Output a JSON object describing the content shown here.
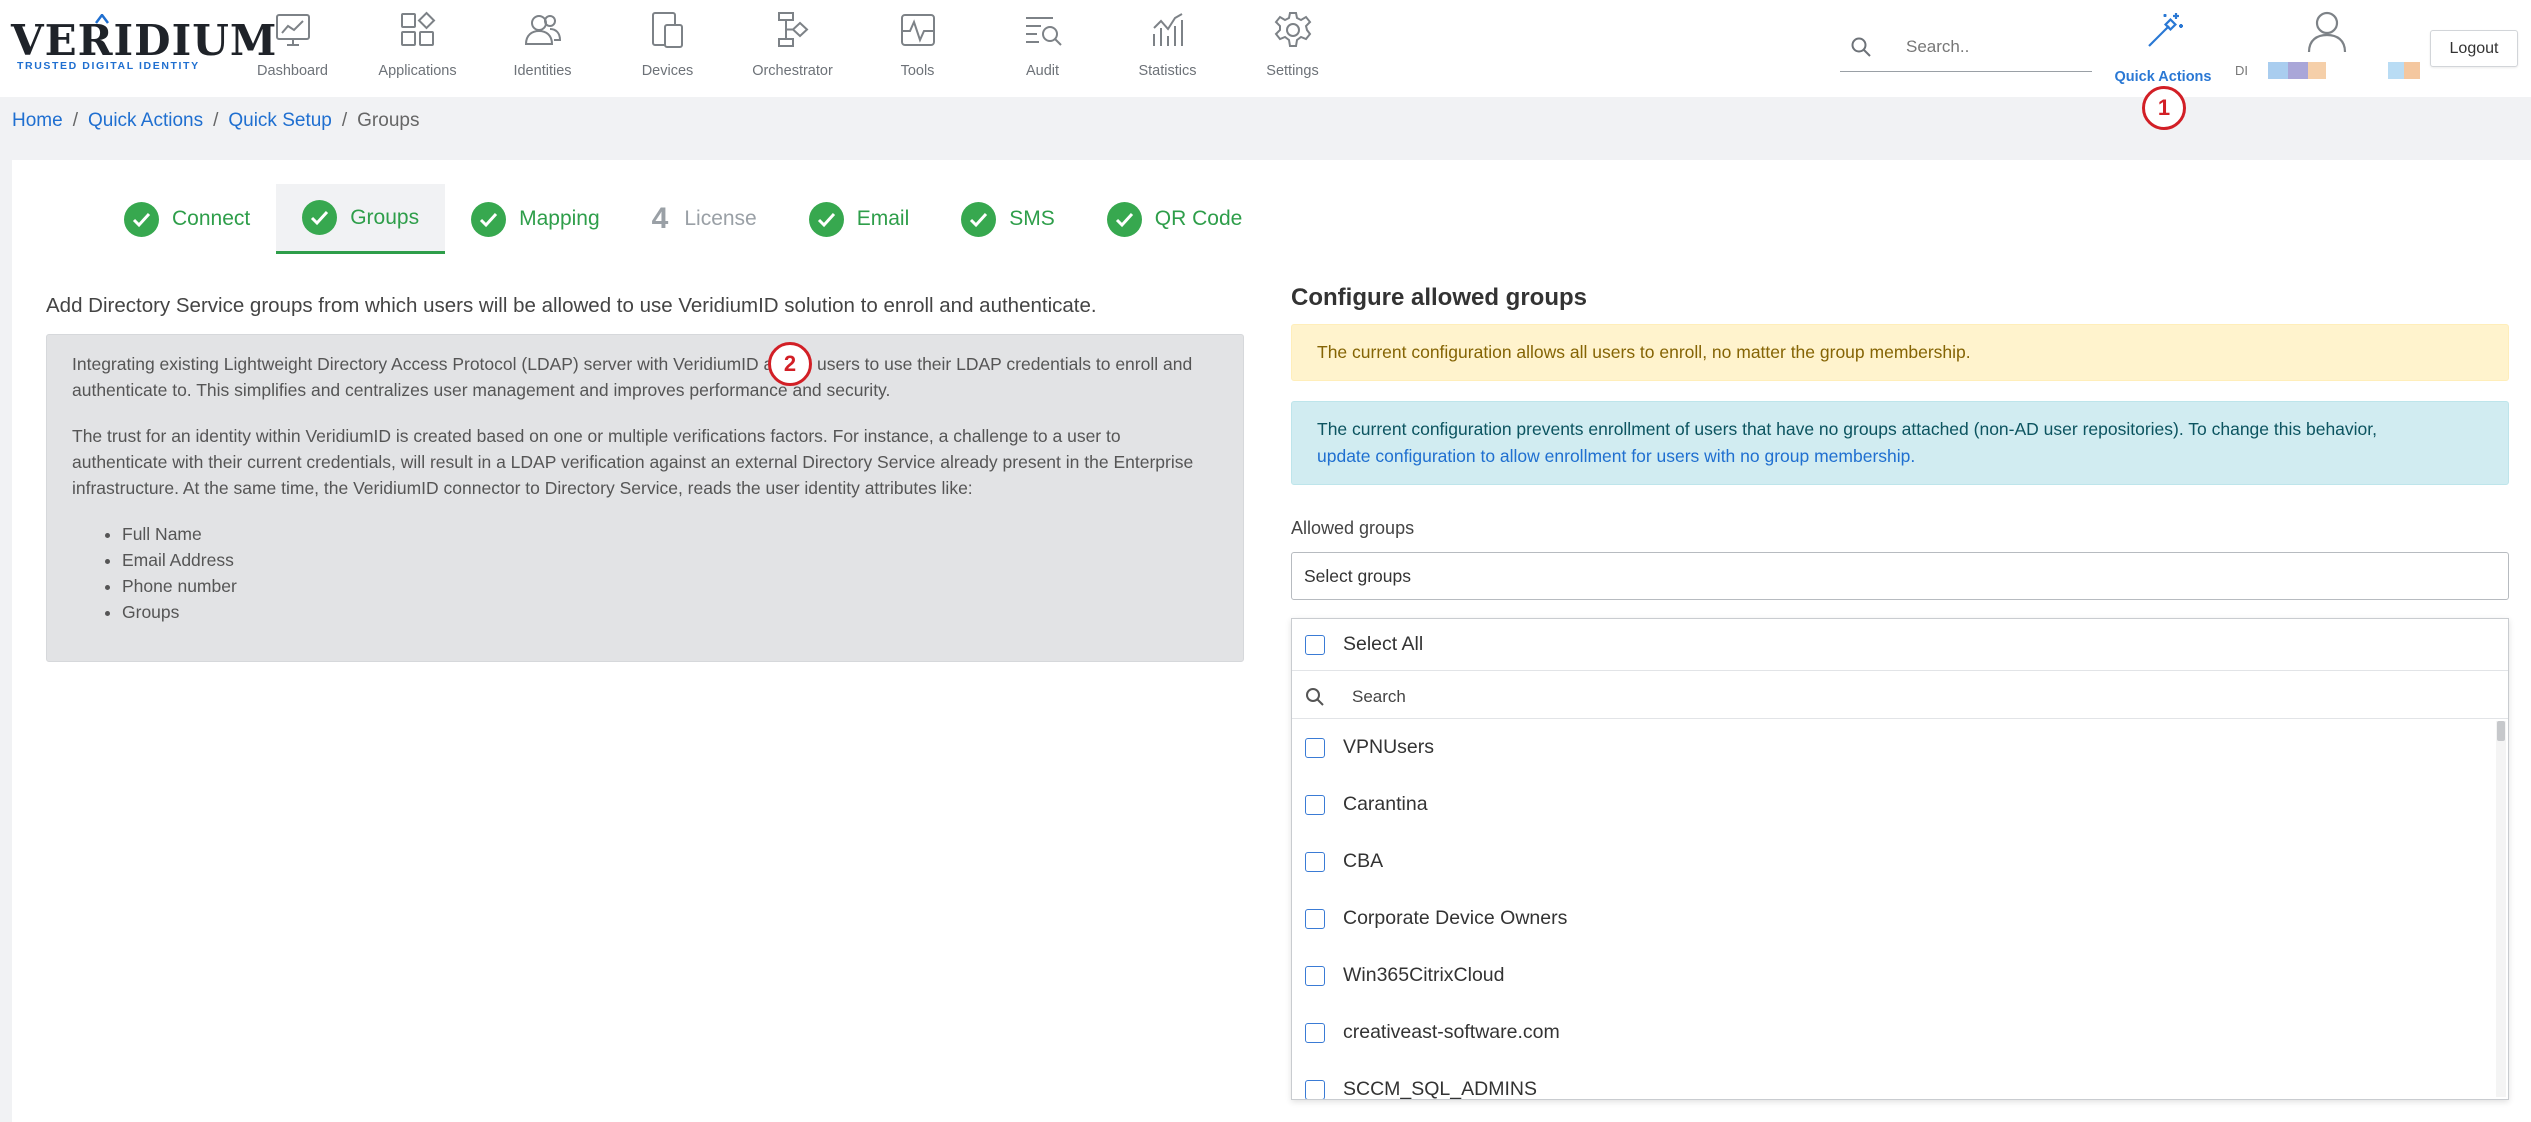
{
  "logo": {
    "word": "VERIDIUM",
    "tagline": "TRUSTED DIGITAL IDENTITY"
  },
  "nav": [
    {
      "id": "dashboard",
      "label": "Dashboard",
      "icon": "dashboard-icon"
    },
    {
      "id": "applications",
      "label": "Applications",
      "icon": "applications-icon"
    },
    {
      "id": "identities",
      "label": "Identities",
      "icon": "identities-icon"
    },
    {
      "id": "devices",
      "label": "Devices",
      "icon": "devices-icon"
    },
    {
      "id": "orchestrator",
      "label": "Orchestrator",
      "icon": "orchestrator-icon"
    },
    {
      "id": "tools",
      "label": "Tools",
      "icon": "tools-icon"
    },
    {
      "id": "audit",
      "label": "Audit",
      "icon": "audit-icon"
    },
    {
      "id": "statistics",
      "label": "Statistics",
      "icon": "statistics-icon"
    },
    {
      "id": "settings",
      "label": "Settings",
      "icon": "gear-icon"
    }
  ],
  "header": {
    "search_placeholder": "Search..",
    "quick_actions_label": "Quick Actions",
    "user_initials": "DI",
    "logout_label": "Logout"
  },
  "markers": {
    "one": "1",
    "two": "2"
  },
  "breadcrumb": {
    "home": "Home",
    "quick_actions": "Quick Actions",
    "quick_setup": "Quick Setup",
    "current": "Groups",
    "separator": "/"
  },
  "steps": [
    {
      "label": "Connect",
      "status": "done"
    },
    {
      "label": "Groups",
      "status": "active"
    },
    {
      "label": "Mapping",
      "status": "done"
    },
    {
      "label": "License",
      "status": "pending",
      "number": "4"
    },
    {
      "label": "Email",
      "status": "done"
    },
    {
      "label": "SMS",
      "status": "done"
    },
    {
      "label": "QR Code",
      "status": "done"
    }
  ],
  "intro": "Add Directory Service groups from which users will be allowed to use VeridiumID solution to enroll and authenticate.",
  "info": {
    "p1": "Integrating existing Lightweight Directory Access Protocol (LDAP) server with VeridiumID allows users to use their LDAP credentials to enroll and authenticate to. This simplifies and centralizes user management and improves performance and security.",
    "p2": "The trust for an identity within VeridiumID is created based on one or multiple verifications factors. For instance, a challenge to a user to authenticate with their current credentials, will result in a LDAP verification against an external Directory Service already present in the Enterprise infrastructure. At the same time, the VeridiumID connector to Directory Service, reads the user identity attributes like:",
    "attributes": [
      "Full Name",
      "Email Address",
      "Phone number",
      "Groups"
    ]
  },
  "configure": {
    "title": "Configure allowed groups",
    "warning": "The current configuration allows all users to enroll, no matter the group membership.",
    "info_text": "The current configuration prevents enrollment of users that have no groups attached (non-AD user repositories). To change this behavior,",
    "info_link": "update configuration to allow enrollment for users with no group membership.",
    "field_label": "Allowed groups",
    "select_placeholder": "Select groups",
    "select_all_label": "Select All",
    "dropdown_search_placeholder": "Search",
    "groups": [
      "VPNUsers",
      "Carantina",
      "CBA",
      "Corporate Device Owners",
      "Win365CitrixCloud",
      "creativeast-software.com",
      "SCCM_SQL_ADMINS"
    ]
  },
  "colors": {
    "accent_blue": "#1f6fd0",
    "success_green": "#37a84f",
    "marker_red": "#d21f26",
    "warning_bg": "#fff3cd",
    "info_bg": "#d1ecf1",
    "avatar_swatches": [
      "#a9cdef",
      "#a9a6d8",
      "#f5cfa9",
      "#b9dcf4",
      "#f4c79f"
    ]
  }
}
